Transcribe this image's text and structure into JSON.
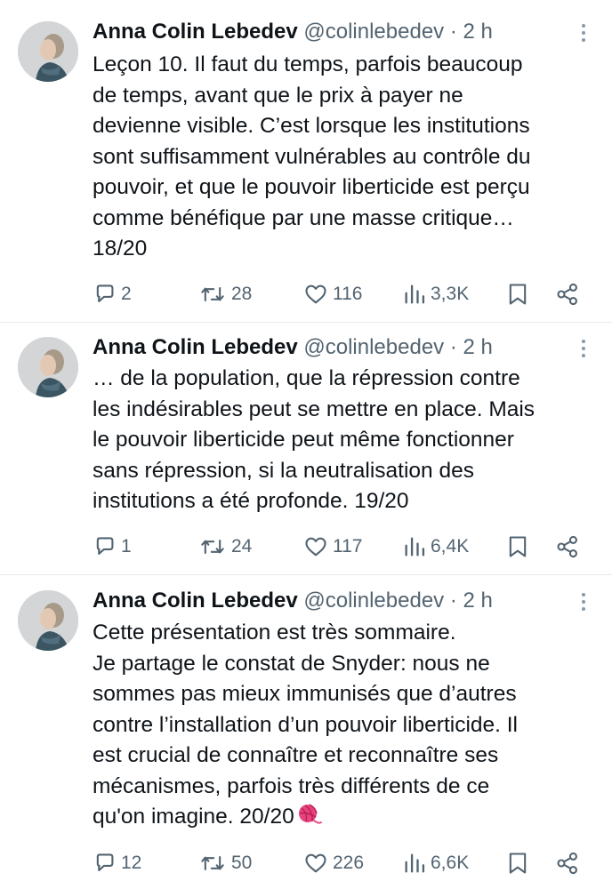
{
  "tweets": [
    {
      "author": "Anna Colin Lebedev",
      "handle": "@colinlebedev",
      "dot": "·",
      "time": "2 h",
      "lines": [
        "Leçon 10. Il faut du temps, parfois beaucoup",
        "de temps, avant que le prix à payer ne",
        "devienne visible. C’est lorsque les institutions",
        "sont suffisamment vulnérables au contrôle du",
        "pouvoir, et que le pouvoir liberticide est perçu",
        "comme bénéfique par une masse critique…",
        "18/20"
      ],
      "replies": "2",
      "reposts": "28",
      "likes": "116",
      "views": "3,3K"
    },
    {
      "author": "Anna Colin Lebedev",
      "handle": "@colinlebedev",
      "dot": "·",
      "time": "2 h",
      "lines": [
        "… de la population, que la répression contre",
        "les indésirables peut se mettre en place. Mais",
        "le pouvoir liberticide peut même fonctionner",
        "sans répression, si la neutralisation des",
        "institutions a été profonde. 19/20"
      ],
      "replies": "1",
      "reposts": "24",
      "likes": "117",
      "views": "6,4K"
    },
    {
      "author": "Anna Colin Lebedev",
      "handle": "@colinlebedev",
      "dot": "·",
      "time": "2 h",
      "lines": [
        "Cette présentation est très sommaire.",
        "Je partage le constat de Snyder: nous ne",
        "sommes pas mieux immunisés que d’autres",
        "contre l’installation d’un pouvoir liberticide. Il",
        "est crucial de connaître et reconnaître ses",
        "mécanismes, parfois très différents de ce",
        "qu'on imagine. 20/20"
      ],
      "emoji": "yarn-ball-emoji",
      "replies": "12",
      "reposts": "50",
      "likes": "226",
      "views": "6,6K"
    }
  ],
  "icons": {
    "reply": "reply-icon",
    "repost": "repost-icon",
    "like": "heart-icon",
    "views": "views-icon",
    "bookmark": "bookmark-icon",
    "share": "share-icon",
    "more": "more-icon"
  },
  "colors": {
    "text": "#0f1419",
    "secondary": "#536471",
    "divider": "#e7e9eb",
    "emoji": "#e8437d"
  }
}
